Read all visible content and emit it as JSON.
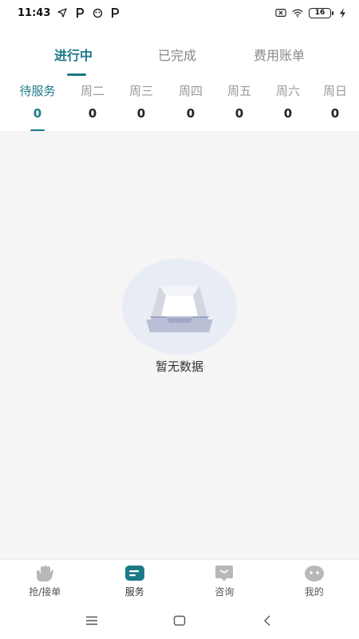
{
  "status_bar": {
    "time": "11:43",
    "battery": "16"
  },
  "top_tabs": [
    {
      "label": "进行中",
      "active": true
    },
    {
      "label": "已完成",
      "active": false
    },
    {
      "label": "费用账单",
      "active": false
    }
  ],
  "day_tabs": [
    {
      "label": "待服务",
      "count": "0",
      "active": true
    },
    {
      "label": "周二",
      "count": "0",
      "active": false
    },
    {
      "label": "周三",
      "count": "0",
      "active": false
    },
    {
      "label": "周四",
      "count": "0",
      "active": false
    },
    {
      "label": "周五",
      "count": "0",
      "active": false
    },
    {
      "label": "周六",
      "count": "0",
      "active": false
    },
    {
      "label": "周日",
      "count": "0",
      "active": false
    }
  ],
  "empty_state": {
    "message": "暂无数据"
  },
  "bottom_nav": [
    {
      "label": "抢/接单",
      "icon": "hand-icon",
      "active": false
    },
    {
      "label": "服务",
      "icon": "service-icon",
      "active": true
    },
    {
      "label": "咨询",
      "icon": "chat-icon",
      "active": false
    },
    {
      "label": "我的",
      "icon": "profile-icon",
      "active": false
    }
  ],
  "colors": {
    "accent": "#1b7a87",
    "inactive_tab": "#888888",
    "content_bg": "#f5f5f5",
    "inactive_icon": "#b8b8b8"
  }
}
